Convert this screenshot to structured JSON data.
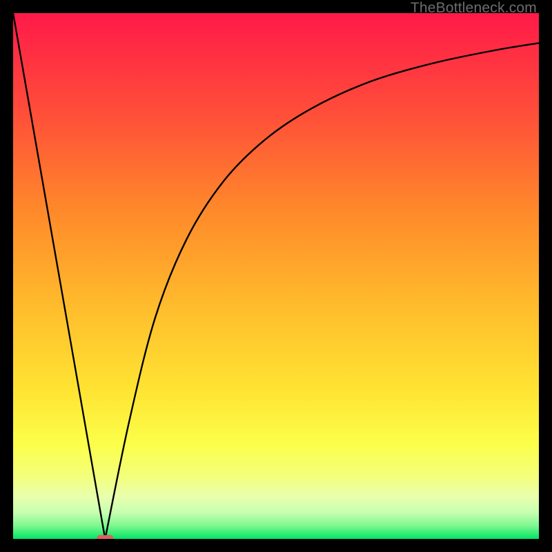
{
  "watermark": "TheBottleneck.com",
  "chart_data": {
    "type": "line",
    "title": "",
    "xlabel": "",
    "ylabel": "",
    "xlim": [
      0,
      100
    ],
    "ylim": [
      0,
      100
    ],
    "grid": false,
    "legend": false,
    "background_gradient": {
      "top": "#ff1a49",
      "mid_top": "#ff8a2a",
      "mid": "#ffe433",
      "mid_low": "#f7ff60",
      "low": "#c7ffb0",
      "bottom": "#00e763"
    },
    "series": [
      {
        "name": "left-branch",
        "x": [
          0,
          17.5
        ],
        "y": [
          100,
          0
        ],
        "note": "straight descending line from top-left to minimum"
      },
      {
        "name": "right-branch",
        "x": [
          17.5,
          22,
          27,
          33,
          40,
          48,
          57,
          68,
          80,
          92,
          100
        ],
        "y": [
          0,
          22,
          42,
          57,
          68,
          76,
          82,
          87,
          90.5,
          93,
          94.3
        ],
        "note": "concave increasing curve approaching ~94 at right edge"
      }
    ],
    "marker": {
      "name": "min-pill",
      "x": 17.5,
      "y": 0,
      "color": "#db6260",
      "width_pct": 3.2,
      "height_pct": 1.2
    }
  }
}
